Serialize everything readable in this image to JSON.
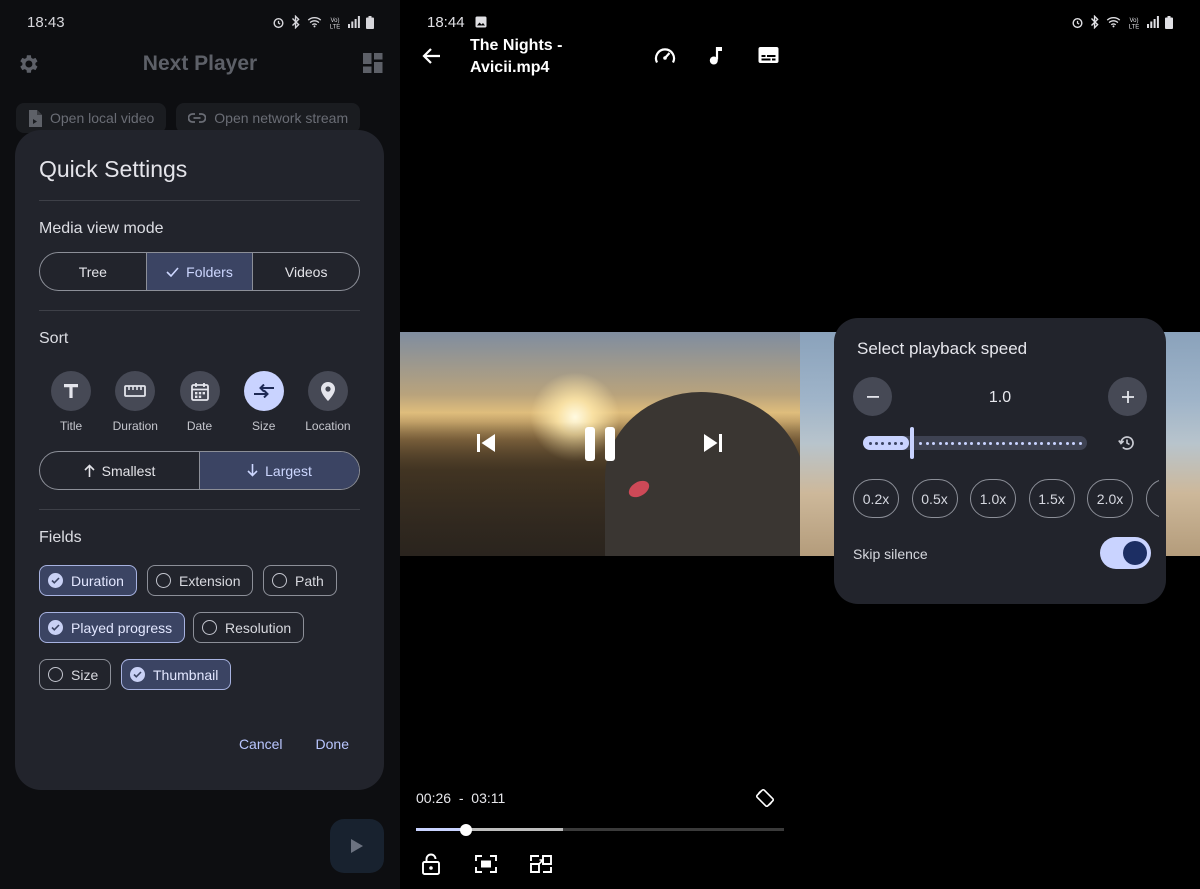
{
  "left": {
    "status_bar": {
      "time": "18:43"
    },
    "app_title": "Next Player",
    "chips": [
      "Open local video",
      "Open network stream"
    ],
    "dialog": {
      "title": "Quick Settings",
      "media_view_mode": {
        "label": "Media view mode",
        "options": [
          "Tree",
          "Folders",
          "Videos"
        ],
        "selected": "Folders"
      },
      "sort": {
        "label": "Sort",
        "options": [
          {
            "label": "Title",
            "icon": "title-icon"
          },
          {
            "label": "Duration",
            "icon": "ruler-icon"
          },
          {
            "label": "Date",
            "icon": "calendar-icon"
          },
          {
            "label": "Size",
            "icon": "compare-arrows-icon"
          },
          {
            "label": "Location",
            "icon": "location-pin-icon"
          }
        ],
        "selected": "Size",
        "order": {
          "options": [
            "Smallest",
            "Largest"
          ],
          "selected": "Largest"
        }
      },
      "fields": {
        "label": "Fields",
        "items": [
          {
            "label": "Duration",
            "checked": true
          },
          {
            "label": "Extension",
            "checked": false
          },
          {
            "label": "Path",
            "checked": false
          },
          {
            "label": "Played progress",
            "checked": true
          },
          {
            "label": "Resolution",
            "checked": false
          },
          {
            "label": "Size",
            "checked": false
          },
          {
            "label": "Thumbnail",
            "checked": true
          }
        ]
      },
      "actions": {
        "cancel": "Cancel",
        "done": "Done"
      }
    }
  },
  "right": {
    "status_bar": {
      "time": "18:44"
    },
    "video_title": "The Nights - Avicii.mp4",
    "speed_dialog": {
      "title": "Select playback speed",
      "value": "1.0",
      "slider_fraction": 0.22,
      "presets": [
        "0.2x",
        "0.5x",
        "1.0x",
        "1.5x",
        "2.0x"
      ],
      "skip_silence": {
        "label": "Skip silence",
        "on": true
      }
    },
    "playback": {
      "position": "00:26",
      "separator": "-",
      "duration": "03:11",
      "played_fraction": 0.136,
      "buffered_fraction": 0.4
    }
  },
  "colors": {
    "accent": "#c9d3ff",
    "dialog_bg": "#22242c",
    "selected_bg": "#3b4463"
  }
}
